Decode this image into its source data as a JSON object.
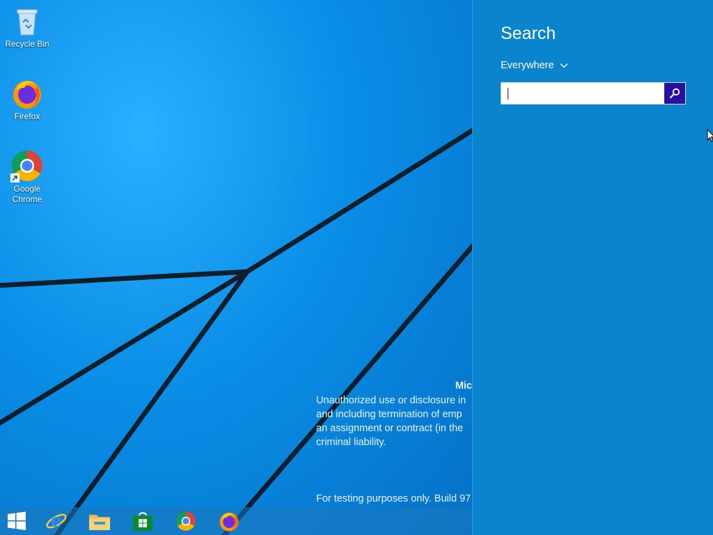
{
  "desktop": {
    "icons": [
      {
        "label": "Recycle Bin",
        "icon": "recycle-bin-icon"
      },
      {
        "label": "Firefox",
        "icon": "firefox-icon"
      },
      {
        "label": "Google Chrome",
        "icon": "chrome-icon"
      }
    ],
    "watermark": {
      "title": "Mic",
      "lines": [
        "Unauthorized use or disclosure in",
        "and including termination of emp",
        "an assignment or contract (in the",
        "criminal liability."
      ],
      "build": "For testing purposes only. Build 97"
    }
  },
  "taskbar": {
    "items": [
      {
        "name": "start-button",
        "icon": "windows-logo-icon"
      },
      {
        "name": "internet-explorer",
        "icon": "internet-explorer-icon"
      },
      {
        "name": "file-explorer",
        "icon": "file-explorer-icon"
      },
      {
        "name": "store",
        "icon": "store-icon"
      },
      {
        "name": "chrome",
        "icon": "chrome-icon"
      },
      {
        "name": "firefox",
        "icon": "firefox-icon"
      }
    ]
  },
  "search_charm": {
    "title": "Search",
    "scope": "Everywhere",
    "input_value": "",
    "button_icon": "search-icon"
  },
  "colors": {
    "charm_bg": "#0a84cd",
    "search_button": "#2b0fa3",
    "desktop_bg": "#0a8ee6"
  }
}
